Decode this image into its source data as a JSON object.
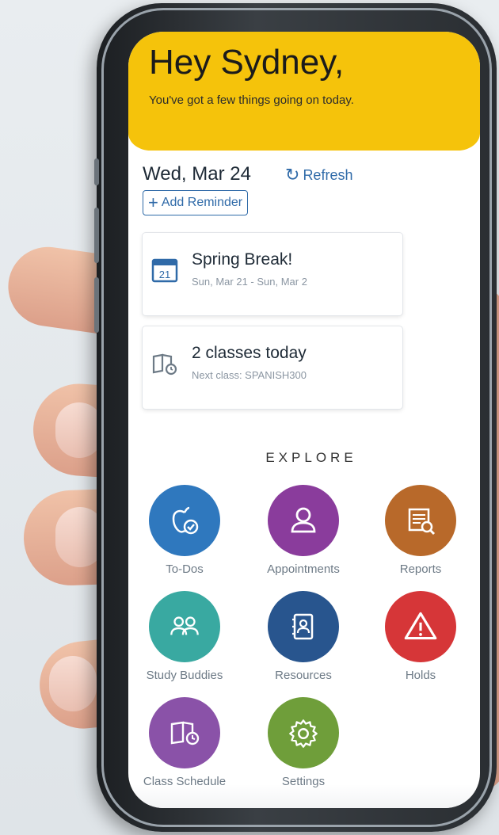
{
  "header": {
    "greeting": "Hey Sydney,",
    "subtitle": "You've got a few things going on today."
  },
  "agenda": {
    "date": "Wed, Mar 24",
    "refresh_label": "Refresh",
    "add_reminder_label": "Add Reminder"
  },
  "cards": [
    {
      "title": "Spring Break!",
      "subtitle": "Sun, Mar 21 - Sun, Mar 2",
      "icon": "calendar-icon",
      "icon_text": "21"
    },
    {
      "title": "2 classes today",
      "subtitle": "Next class: SPANISH300",
      "icon": "class-schedule-icon"
    }
  ],
  "explore": {
    "heading": "EXPLORE",
    "items": [
      {
        "label": "To-Dos",
        "icon": "apple-check-icon",
        "color": "#2f78be"
      },
      {
        "label": "Appointments",
        "icon": "person-icon",
        "color": "#8a3c9c"
      },
      {
        "label": "Reports",
        "icon": "report-search-icon",
        "color": "#b8692a"
      },
      {
        "label": "Study Buddies",
        "icon": "group-icon",
        "color": "#39a9a1"
      },
      {
        "label": "Resources",
        "icon": "address-book-icon",
        "color": "#28558e"
      },
      {
        "label": "Holds",
        "icon": "warning-icon",
        "color": "#d63638"
      },
      {
        "label": "Class Schedule",
        "icon": "book-clock-icon",
        "color": "#8a52a8"
      },
      {
        "label": "Settings",
        "icon": "gear-icon",
        "color": "#6f9e3a"
      }
    ]
  }
}
